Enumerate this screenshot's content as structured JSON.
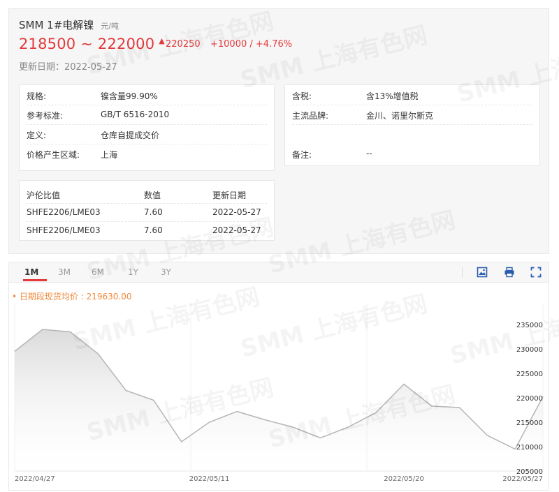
{
  "product": {
    "name": "SMM 1#电解镍",
    "unit": "元/吨",
    "price_range": "218500 ~ 222000",
    "avg_price": "220250",
    "change": "+10000 / +4.76%",
    "update_date": "更新日期：2022-05-27",
    "watermark_text": "SMM 上海有色网"
  },
  "specs_left": [
    {
      "label": "规格:",
      "value": "镍含量99.90%"
    },
    {
      "label": "参考标准:",
      "value": "GB/T 6516-2010"
    },
    {
      "label": "定义:",
      "value": "仓库自提成交价"
    },
    {
      "label": "价格产生区域:",
      "value": "上海"
    }
  ],
  "specs_right": [
    {
      "label": "含税:",
      "value": "含13%增值税"
    },
    {
      "label": "主流品牌:",
      "value": "金川、诺里尔斯克"
    },
    {
      "label": "备注:",
      "value": "--"
    }
  ],
  "ratio_table": {
    "headers": [
      "沪伦比值",
      "数值",
      "更新日期"
    ],
    "rows": [
      [
        "SHFE2206/LME03",
        "7.60",
        "2022-05-27"
      ],
      [
        "SHFE2206/LME03",
        "7.60",
        "2022-05-27"
      ]
    ]
  },
  "chart_tabs": [
    "1M",
    "3M",
    "6M",
    "1Y",
    "3Y"
  ],
  "chart_active_tab": "1M",
  "chart_data": {
    "type": "area",
    "avg_label": "• 日期段现货均价 : 219630.00",
    "x": [
      "2022/04/27",
      "2022/04/28",
      "2022/04/29",
      "2022/05/05",
      "2022/05/06",
      "2022/05/09",
      "2022/05/10",
      "2022/05/11",
      "2022/05/12",
      "2022/05/13",
      "2022/05/16",
      "2022/05/17",
      "2022/05/18",
      "2022/05/19",
      "2022/05/20",
      "2022/05/23",
      "2022/05/24",
      "2022/05/25",
      "2022/05/26",
      "2022/05/27"
    ],
    "values": [
      229500,
      234000,
      233500,
      229000,
      221500,
      219500,
      211000,
      215000,
      217200,
      215500,
      214000,
      211800,
      214000,
      217000,
      222800,
      218300,
      218000,
      212300,
      209500,
      220250
    ],
    "x_tick_labels": [
      "2022/04/27",
      "2022/05/11",
      "2022/05/20",
      "2022/05/27"
    ],
    "x_tick_indices": [
      0,
      7,
      14,
      19
    ],
    "y_ticks": [
      205000,
      210000,
      215000,
      220000,
      225000,
      230000,
      235000
    ],
    "ylim": [
      205000,
      238000
    ],
    "line_color": "#b5b5b5",
    "area_color": "#cfcfcf",
    "avg_color": "#f08a3c"
  }
}
